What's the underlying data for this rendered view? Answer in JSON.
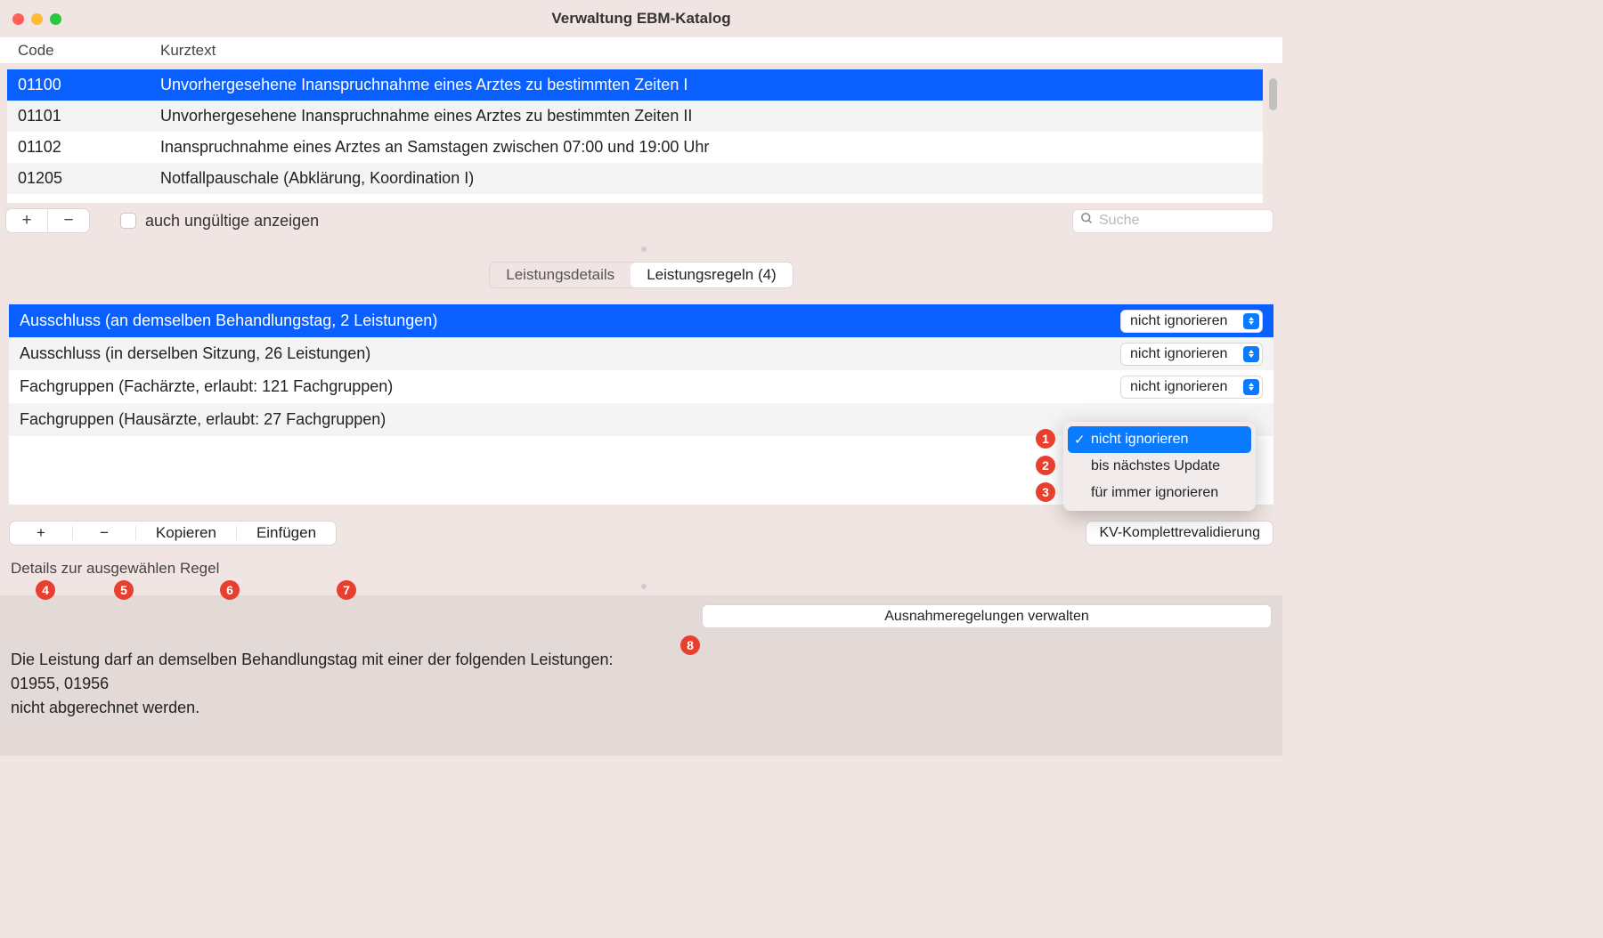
{
  "window": {
    "title": "Verwaltung EBM-Katalog"
  },
  "headers": {
    "code": "Code",
    "kurztext": "Kurztext"
  },
  "catalog": [
    {
      "code": "01100",
      "text": "Unvorhergesehene Inanspruchnahme eines Arztes zu bestimmten Zeiten I",
      "selected": true
    },
    {
      "code": "01101",
      "text": "Unvorhergesehene Inanspruchnahme eines Arztes zu bestimmten Zeiten II"
    },
    {
      "code": "01102",
      "text": "Inanspruchnahme eines Arztes an Samstagen zwischen 07:00 und 19:00 Uhr"
    },
    {
      "code": "01205",
      "text": "Notfallpauschale (Abklärung, Koordination I)"
    }
  ],
  "toolbar": {
    "plus": "+",
    "minus": "−",
    "checkbox_label": "auch ungültige anzeigen",
    "search_placeholder": "Suche"
  },
  "tabs": {
    "details": "Leistungsdetails",
    "rules": "Leistungsregeln (4)"
  },
  "rules": [
    {
      "text": "Ausschluss (an demselben Behandlungstag, 2 Leistungen)",
      "value": "nicht ignorieren",
      "selected": true
    },
    {
      "text": "Ausschluss (in derselben Sitzung, 26 Leistungen)",
      "value": "nicht ignorieren"
    },
    {
      "text": "Fachgruppen (Fachärzte, erlaubt: 121 Fachgruppen)",
      "value": "nicht ignorieren"
    },
    {
      "text": "Fachgruppen (Hausärzte, erlaubt: 27 Fachgruppen)",
      "value": ""
    }
  ],
  "popup": {
    "opt1": "nicht ignorieren",
    "opt2": "bis nächstes Update",
    "opt3": "für immer ignorieren"
  },
  "lower": {
    "plus": "+",
    "minus": "−",
    "copy": "Kopieren",
    "paste": "Einfügen",
    "kv": "KV-Komplettrevalidierung",
    "detail_label": "Details zur ausgewählen Regel",
    "aus_btn": "Ausnahmeregelungen verwalten",
    "body1": "Die Leistung darf an demselben Behandlungstag mit einer der folgenden Leistungen:",
    "body2": "01955, 01956",
    "body3": "nicht abgerechnet werden."
  },
  "badges": {
    "b1": "1",
    "b2": "2",
    "b3": "3",
    "b4": "4",
    "b5": "5",
    "b6": "6",
    "b7": "7",
    "b8": "8"
  }
}
